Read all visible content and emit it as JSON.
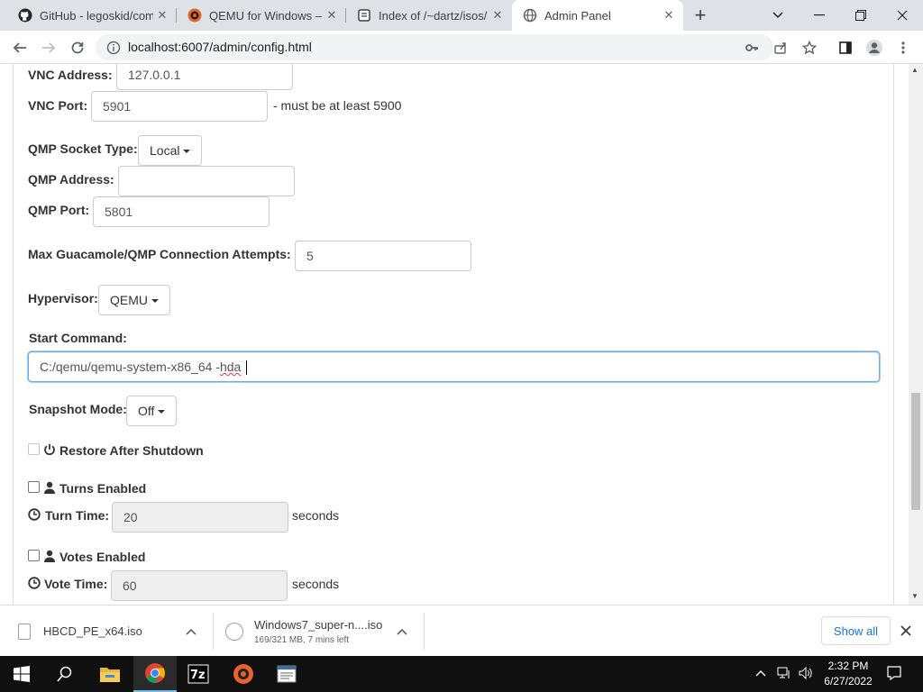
{
  "browser": {
    "tabs": [
      {
        "title": "GitHub - legoskid/com",
        "icon": "github-icon"
      },
      {
        "title": "QEMU for Windows – I",
        "icon": "qemu-icon"
      },
      {
        "title": "Index of /~dartz/isos/",
        "icon": "page-icon"
      },
      {
        "title": "Admin Panel",
        "icon": "globe-icon",
        "active": true
      }
    ],
    "url": "localhost:6007/admin/config.html"
  },
  "form": {
    "vnc_address_label": "VNC Address:",
    "vnc_address_value": "127.0.0.1",
    "vnc_port_label": "VNC Port:",
    "vnc_port_value": "5901",
    "vnc_port_note": "- must be at least 5900",
    "qmp_socket_type_label": "QMP Socket Type:",
    "qmp_socket_type_value": "Local",
    "qmp_address_label": "QMP Address:",
    "qmp_address_value": "",
    "qmp_port_label": "QMP Port:",
    "qmp_port_value": "5801",
    "max_attempts_label": "Max Guacamole/QMP Connection Attempts:",
    "max_attempts_value": "5",
    "hypervisor_label": "Hypervisor:",
    "hypervisor_value": "QEMU",
    "start_command_label": "Start Command:",
    "start_command_prefix": "C:/qemu/qemu-system-x86_64 -",
    "start_command_misspelled": "hda",
    "start_command_suffix": " ",
    "snapshot_mode_label": "Snapshot Mode:",
    "snapshot_mode_value": "Off",
    "restore_after_shutdown_label": "Restore After Shutdown",
    "turns_enabled_label": "Turns Enabled",
    "turn_time_label": "Turn Time:",
    "turn_time_value": "20",
    "turn_time_unit": "seconds",
    "votes_enabled_label": "Votes Enabled",
    "vote_time_label": "Vote Time:",
    "vote_time_value": "60",
    "vote_time_unit": "seconds"
  },
  "downloads": {
    "items": [
      {
        "name": "HBCD_PE_x64.iso",
        "status": ""
      },
      {
        "name": "Windows7_super-n....iso",
        "status": "169/321 MB, 7 mins left"
      }
    ],
    "show_all": "Show all"
  },
  "taskbar": {
    "time": "2:32 PM",
    "date": "6/27/2022"
  }
}
